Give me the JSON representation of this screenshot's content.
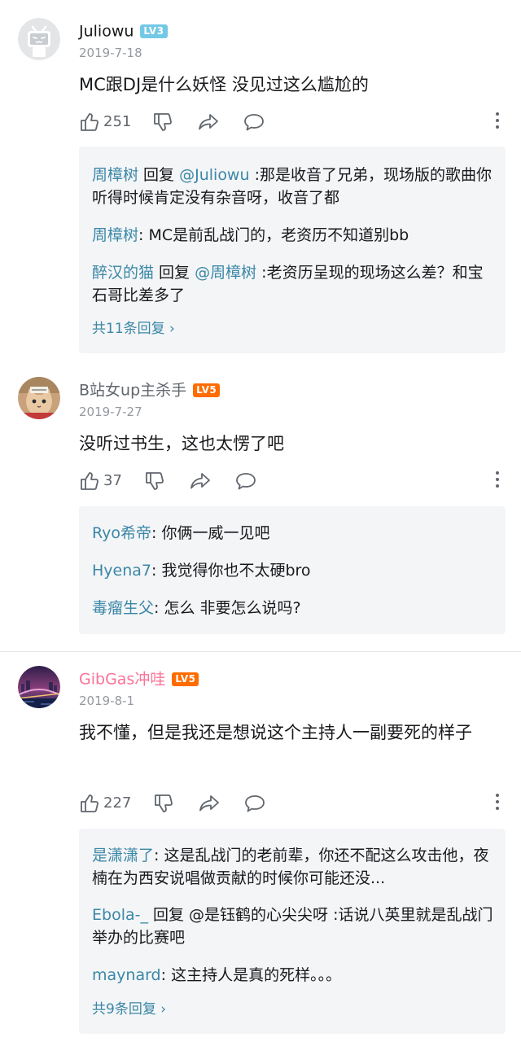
{
  "comments": [
    {
      "username": "Juliowu",
      "level": "LV3",
      "level_color": "#73c9e5",
      "name_color": "#18191c",
      "date": "2019-7-18",
      "text": "MC跟DJ是什么妖怪 没见过这么尴尬的",
      "likes": "251",
      "avatar": "default-bilibili-tv-avatar",
      "replies": [
        {
          "name": "周樟树",
          "text": " 回复 ",
          "mention": "@Juliowu",
          "rest": " :那是收音了兄弟，现场版的歌曲你听得时候肯定没有杂音呀，收音了都"
        },
        {
          "name": "周樟树",
          "text": ": MC是前乱战门的，老资历不知道别bb"
        },
        {
          "name": "醉汉的猫",
          "text": " 回复 ",
          "mention": "@周樟树",
          "rest": " :老资历呈现的现场这么差？和宝石哥比差多了"
        }
      ],
      "more_replies": "共11条回复 ›"
    },
    {
      "username": "B站女up主杀手",
      "level": "LV5",
      "level_color": "#ff6c00",
      "name_color": "#61666d",
      "date": "2019-7-27",
      "text": "没听过书生，这也太愣了吧",
      "likes": "37",
      "avatar": "cat-avatar",
      "replies": [
        {
          "name": "Ryo希帝",
          "text": ": 你俩一威一见吧"
        },
        {
          "name": "Hyena7",
          "text": ": 我觉得你也不太硬bro"
        },
        {
          "name": "毒瘤生父",
          "text": ": 怎么 非要怎么说吗?"
        }
      ]
    },
    {
      "username": "GibGas冲哇",
      "level": "LV5",
      "level_color": "#ff6c00",
      "name_color": "#fb7299",
      "date": "2019-8-1",
      "text": "我不懂，但是我还是想说这个主持人一副要死的样子",
      "likes": "227",
      "avatar": "city-bridge-night-avatar",
      "replies": [
        {
          "name": "是潇潇了",
          "text": ": 这是乱战门的老前辈，你还不配这么攻击他，夜楠在为西安说唱做贡献的时候你可能还没..."
        },
        {
          "name": "Ebola-_",
          "text": " 回复 @是钰鹤的心尖尖呀 :话说八英里就是乱战门举办的比赛吧"
        },
        {
          "name": "maynard",
          "text": ": 这主持人是真的死样。。。"
        }
      ],
      "more_replies": "共9条回复 ›"
    }
  ],
  "icons": {
    "like": "thumbs-up-icon",
    "dislike": "thumbs-down-icon",
    "share": "share-arrow-icon",
    "reply": "speech-bubble-icon",
    "more": "more-vertical-icon"
  },
  "accent_color": "#3a87a6"
}
